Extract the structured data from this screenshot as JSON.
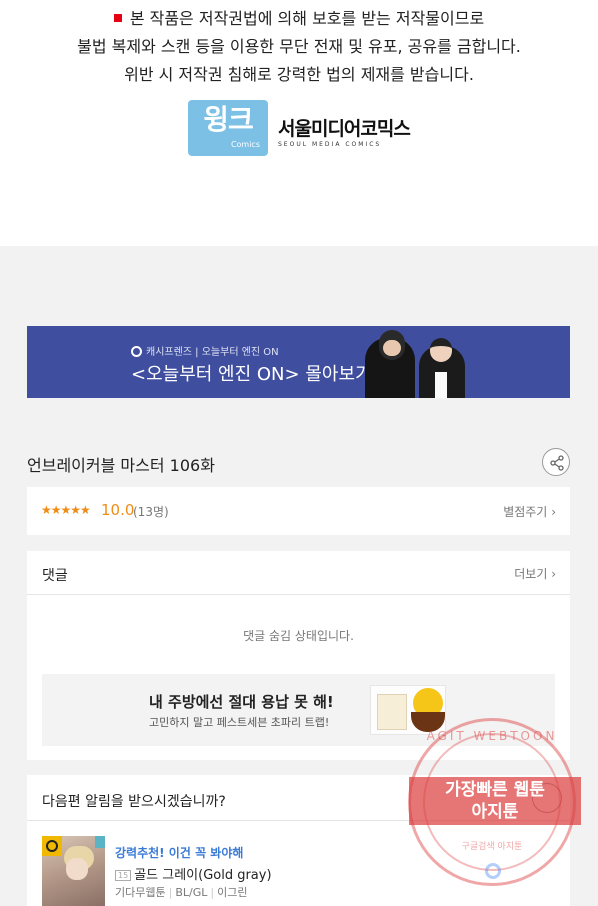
{
  "notice": {
    "line1": "본 작품은 저작권법에 의해 보호를 받는 저작물이므로",
    "line2": "불법 복제와 스캔 등을 이용한 무단 전재 및 유포, 공유를 금합니다.",
    "line3": "위반 시 저작권 침해로 강력한 법의 제재를 받습니다."
  },
  "logos": {
    "wink_main": "윙크",
    "wink_sub": "Comics",
    "seoul_korean": "서울미디어코믹스",
    "seoul_english": "SEOUL MEDIA COMICS"
  },
  "banner": {
    "sub": "캐시프렌즈 | 오늘부터 엔진 ON",
    "main": "<오늘부터 엔진 ON> 몰아보기!"
  },
  "episode": {
    "title": "언브레이커블 마스터 106화"
  },
  "rating": {
    "stars": "★★★★★",
    "score": "10.0",
    "count": "(13명)",
    "give_label": "별점주기"
  },
  "comments": {
    "title": "댓글",
    "more_label": "더보기",
    "hidden_text": "댓글 숨김 상태입니다."
  },
  "ad": {
    "headline": "내 주방에선 절대 용납 못 해!",
    "subline": "고민하지 말고 페스트세븐 초파리 트랩!"
  },
  "subscribe": {
    "question": "다음편 알림을 받으시겠습니까?"
  },
  "recommendation": {
    "label": "강력추천! 이건 꼭 봐야해",
    "badge": "15",
    "title": "골드 그레이(Gold gray)",
    "platform": "기다무웹툰",
    "genre": "BL/GL",
    "author": "이그린"
  },
  "watermark": {
    "arc": "AGIT WEBTOON",
    "line1": "가장빠른 웹툰",
    "line2": "아지툰",
    "foot": "구글검색 아지툰"
  },
  "colors": {
    "banner_bg": "#3f4e9e",
    "rating_orange": "#f08c16",
    "link_blue": "#3a7bd5",
    "stamp_red": "#dc3c3c"
  }
}
